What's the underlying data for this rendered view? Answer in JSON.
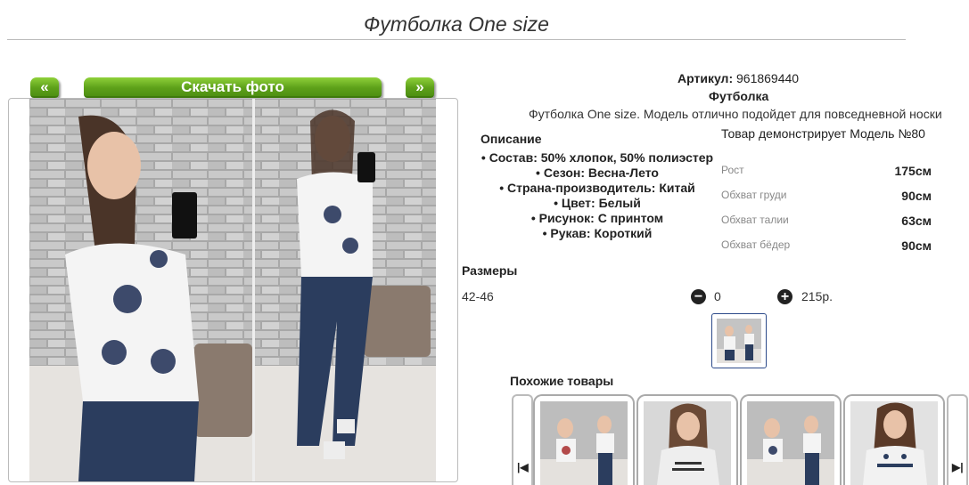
{
  "page": {
    "title": "Футболка One size"
  },
  "gallery": {
    "prev_label": "«",
    "next_label": "»",
    "download_label": "Скачать фото"
  },
  "product": {
    "article_label": "Артикул:",
    "article_value": "961869440",
    "category": "Футболка",
    "description": "Футболка One size. Модель отлично подойдет для повседневной носки",
    "model_note": "Товар демонстрирует Модель №80"
  },
  "description_section": {
    "title": "Описание",
    "items": [
      "Состав: 50% хлопок, 50% полиэстер",
      "Сезон: Весна-Лето",
      "Страна-производитель: Китай",
      "Цвет: Белый",
      "Рисунок: С принтом",
      "Рукав: Короткий"
    ]
  },
  "measurements": [
    {
      "label": "Рост",
      "value": "175см"
    },
    {
      "label": "Обхват груди",
      "value": "90см"
    },
    {
      "label": "Обхват талии",
      "value": "63см"
    },
    {
      "label": "Обхват бёдер",
      "value": "90см"
    }
  ],
  "sizes": {
    "title": "Размеры",
    "size": "42-46",
    "qty": "0",
    "price": "215р."
  },
  "similar": {
    "title": "Похожие товары"
  },
  "colors": {
    "accent_green": "#6bb022",
    "thumb_border": "#2c4a8a"
  }
}
